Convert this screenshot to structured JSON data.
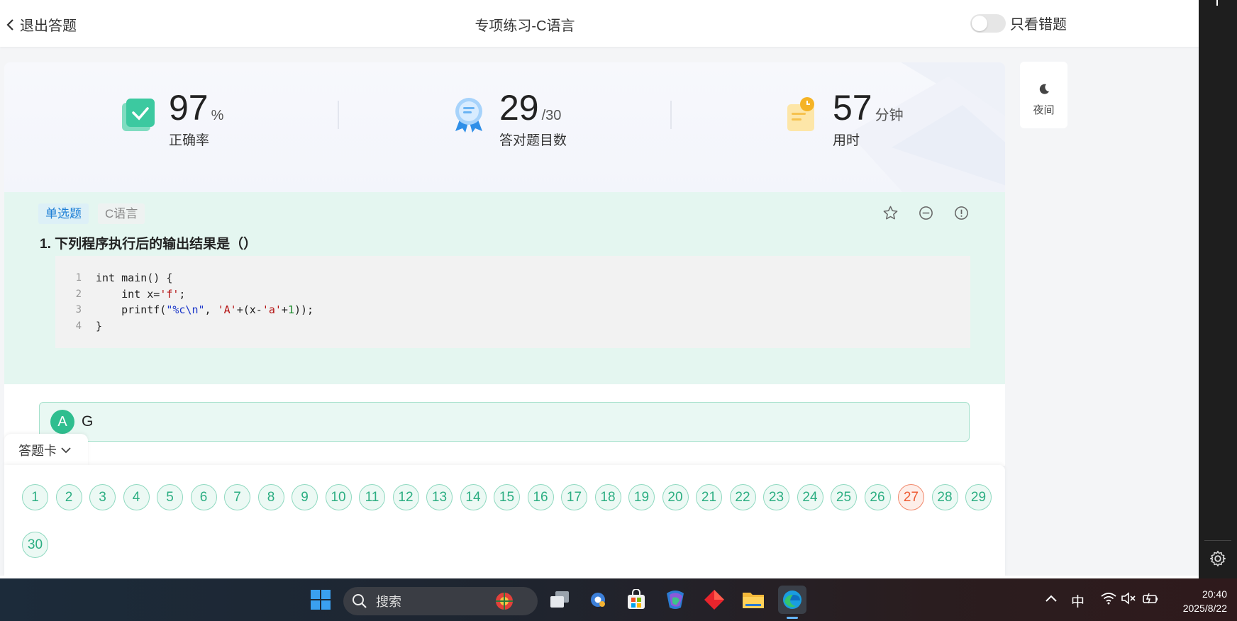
{
  "header": {
    "back_label": "退出答题",
    "title": "专项练习-C语言",
    "wrong_only_label": "只看错题",
    "wrong_only_on": false
  },
  "stats": {
    "accuracy": {
      "value": "97",
      "unit": "%",
      "label": "正确率"
    },
    "correct": {
      "value": "29",
      "unit": "/30",
      "label": "答对题目数"
    },
    "time": {
      "value": "57",
      "unit": "分钟",
      "label": "用时"
    }
  },
  "night_mode": {
    "label": "夜间"
  },
  "question": {
    "type_tag": "单选题",
    "subject_tag": "C语言",
    "title": "1. 下列程序执行后的输出结果是（）",
    "code_lines": [
      {
        "no": "1",
        "text": "int main() {"
      },
      {
        "no": "2",
        "text": "    int x='f';"
      },
      {
        "no": "3",
        "text": "    printf(\"%c\\n\", 'A'+(x-'a'+1));"
      },
      {
        "no": "4",
        "text": "}"
      }
    ]
  },
  "answer": {
    "letter": "A",
    "text": "G"
  },
  "answer_card": {
    "label": "答题卡",
    "numbers": [
      "1",
      "2",
      "3",
      "4",
      "5",
      "6",
      "7",
      "8",
      "9",
      "10",
      "11",
      "12",
      "13",
      "14",
      "15",
      "16",
      "17",
      "18",
      "19",
      "20",
      "21",
      "22",
      "23",
      "24",
      "25",
      "26",
      "27",
      "28",
      "29",
      "30"
    ],
    "wrong": [
      "27"
    ]
  },
  "colors": {
    "accent_green": "#2fbe8f",
    "wrong_orange": "#ee5b33",
    "link_blue": "#1d7fd6"
  },
  "taskbar": {
    "search_placeholder": "搜索",
    "ime": "中",
    "time": "20:40",
    "date": "2025/8/22"
  }
}
